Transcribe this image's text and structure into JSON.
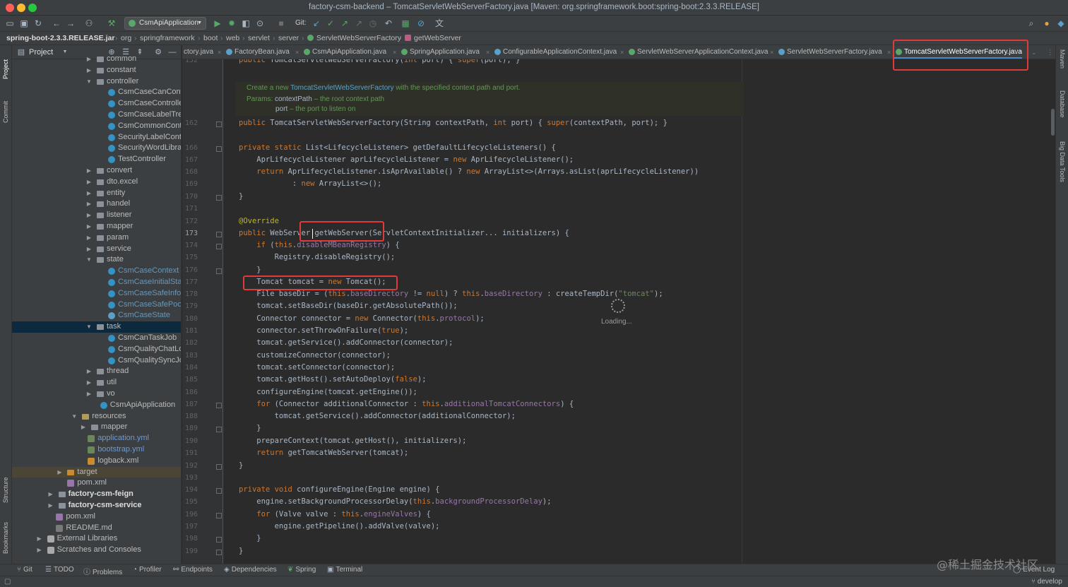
{
  "window": {
    "title": "factory-csm-backend – TomcatServletWebServerFactory.java [Maven: org.springframework.boot:spring-boot:2.3.3.RELEASE]"
  },
  "toolbar": {
    "run_config": "CsmApiApplication",
    "git_label": "Git:"
  },
  "navbar": {
    "crumbs": [
      "spring-boot-2.3.3.RELEASE.jar",
      "org",
      "springframework",
      "boot",
      "web",
      "servlet",
      "server",
      "ServletWebServerFactory",
      "getWebServer"
    ]
  },
  "left_stripe": {
    "tabs": [
      "Project",
      "Commit",
      "Structure",
      "Bookmarks"
    ]
  },
  "right_stripe": {
    "tabs": [
      "Maven",
      "Database",
      "Big Data Tools"
    ]
  },
  "project_panel": {
    "title": "Project",
    "tree": [
      {
        "label": "common",
        "type": "folder",
        "indent": 1,
        "arrow": "right"
      },
      {
        "label": "constant",
        "type": "folder",
        "indent": 1,
        "arrow": "right"
      },
      {
        "label": "controller",
        "type": "folder",
        "indent": 1,
        "arrow": "down"
      },
      {
        "label": "CsmCaseCanControlle",
        "type": "class",
        "indent": 2
      },
      {
        "label": "CsmCaseController",
        "type": "class",
        "indent": 2
      },
      {
        "label": "CsmCaseLabelTreeCo",
        "type": "class",
        "indent": 2
      },
      {
        "label": "CsmCommonControlle",
        "type": "class",
        "indent": 2
      },
      {
        "label": "SecurityLabelControlle",
        "type": "class",
        "indent": 2
      },
      {
        "label": "SecurityWordLibraryC",
        "type": "class",
        "indent": 2
      },
      {
        "label": "TestController",
        "type": "class",
        "indent": 2
      },
      {
        "label": "convert",
        "type": "folder",
        "indent": 1,
        "arrow": "right"
      },
      {
        "label": "dto.excel",
        "type": "folder",
        "indent": 1,
        "arrow": "right"
      },
      {
        "label": "entity",
        "type": "folder",
        "indent": 1,
        "arrow": "right"
      },
      {
        "label": "handel",
        "type": "folder",
        "indent": 1,
        "arrow": "right"
      },
      {
        "label": "listener",
        "type": "folder",
        "indent": 1,
        "arrow": "right"
      },
      {
        "label": "mapper",
        "type": "folder",
        "indent": 1,
        "arrow": "right"
      },
      {
        "label": "param",
        "type": "folder",
        "indent": 1,
        "arrow": "right"
      },
      {
        "label": "service",
        "type": "folder",
        "indent": 1,
        "arrow": "right"
      },
      {
        "label": "state",
        "type": "folder",
        "indent": 1,
        "arrow": "down"
      },
      {
        "label": "CsmCaseContext",
        "type": "class-blue",
        "indent": 2
      },
      {
        "label": "CsmCaseInitialState",
        "type": "class-blue",
        "indent": 2
      },
      {
        "label": "CsmCaseSafeInfoState",
        "type": "class-blue",
        "indent": 2
      },
      {
        "label": "CsmCaseSafePoolStat",
        "type": "class-blue",
        "indent": 2
      },
      {
        "label": "CsmCaseState",
        "type": "interface-blue",
        "indent": 2
      },
      {
        "label": "task",
        "type": "folder",
        "indent": 1,
        "arrow": "down",
        "selected": true
      },
      {
        "label": "CsmCanTaskJob",
        "type": "class",
        "indent": 2
      },
      {
        "label": "CsmQualityChatLogJo",
        "type": "class",
        "indent": 2
      },
      {
        "label": "CsmQualitySyncJob",
        "type": "class",
        "indent": 2
      },
      {
        "label": "thread",
        "type": "folder",
        "indent": 1,
        "arrow": "right"
      },
      {
        "label": "util",
        "type": "folder",
        "indent": 1,
        "arrow": "right"
      },
      {
        "label": "vo",
        "type": "folder",
        "indent": 1,
        "arrow": "right"
      },
      {
        "label": "CsmApiApplication",
        "type": "class",
        "indent": 1.3
      },
      {
        "label": "resources",
        "type": "folder-res",
        "indent": -0.3,
        "arrow": "down"
      },
      {
        "label": "mapper",
        "type": "folder",
        "indent": 0.5,
        "arrow": "right"
      },
      {
        "label": "application.yml",
        "type": "yml",
        "indent": 0.2
      },
      {
        "label": "bootstrap.yml",
        "type": "yml",
        "indent": 0.2
      },
      {
        "label": "logback.xml",
        "type": "xml",
        "indent": 0.2
      },
      {
        "label": "target",
        "type": "folder-target",
        "indent": -1.6,
        "arrow": "right",
        "highlight": true
      },
      {
        "label": "pom.xml",
        "type": "mod",
        "indent": -1.6
      },
      {
        "label": "factory-csm-feign",
        "type": "module",
        "indent": -2.4,
        "arrow": "right"
      },
      {
        "label": "factory-csm-service",
        "type": "module",
        "indent": -2.4,
        "arrow": "right"
      },
      {
        "label": "pom.xml",
        "type": "mod",
        "indent": -2.6
      },
      {
        "label": "README.md",
        "type": "md",
        "indent": -2.6
      },
      {
        "label": "External Libraries",
        "type": "lib",
        "indent": -3.4,
        "arrow": "right"
      },
      {
        "label": "Scratches and Consoles",
        "type": "lib",
        "indent": -3.4,
        "arrow": "right"
      }
    ]
  },
  "tabs": [
    {
      "label": "ctory.java",
      "icon": "class"
    },
    {
      "label": "FactoryBean.java",
      "icon": "interface"
    },
    {
      "label": "CsmApiApplication.java",
      "icon": "class"
    },
    {
      "label": "SpringApplication.java",
      "icon": "class"
    },
    {
      "label": "ConfigurableApplicationContext.java",
      "icon": "interface"
    },
    {
      "label": "ServletWebServerApplicationContext.java",
      "icon": "class"
    },
    {
      "label": "ServletWebServerFactory.java",
      "icon": "interface"
    },
    {
      "label": "TomcatServletWebServerFactory.java",
      "icon": "class",
      "active": true
    }
  ],
  "editor": {
    "doc": {
      "line1_pre": "Create a new ",
      "line1_link": "TomcatServletWebServerFactory",
      "line1_post": " with the specified context path and port.",
      "params_label": "Params:",
      "param1_name": "contextPath",
      "param1_desc": " – the root context path",
      "param2_name": "port",
      "param2_desc": " – the port to listen on"
    },
    "line_numbers": [
      "152",
      "",
      "",
      "",
      "162",
      "166",
      "167",
      "168",
      "169",
      "170",
      "171",
      "172",
      "173",
      "174",
      "175",
      "176",
      "177",
      "178",
      "179",
      "180",
      "181",
      "182",
      "183",
      "184",
      "185",
      "186",
      "187",
      "188",
      "189",
      "190",
      "191",
      "192",
      "193",
      "194",
      "195",
      "196",
      "197",
      "198",
      "199"
    ],
    "loading_text": "Loading...",
    "code": {
      "l152": "public TomcatServletWebServerFactory(int port) { super(port); }",
      "l162": "public TomcatServletWebServerFactory(String contextPath, int port) { super(contextPath, port); }",
      "l166": "private static List<LifecycleListener> getDefaultLifecycleListeners() {",
      "l167": "    AprLifecycleListener aprLifecycleListener = new AprLifecycleListener();",
      "l168": "    return AprLifecycleListener.isAprAvailable() ? new ArrayList<>(Arrays.asList(aprLifecycleListener))",
      "l169": "            : new ArrayList<>();",
      "l170": "}",
      "l172": "@Override",
      "l173": "public WebServer getWebServer(ServletContextInitializer... initializers) {",
      "l174": "    if (this.disableMBeanRegistry) {",
      "l175": "        Registry.disableRegistry();",
      "l176": "    }",
      "l177": "    Tomcat tomcat = new Tomcat();",
      "l178": "    File baseDir = (this.baseDirectory != null) ? this.baseDirectory : createTempDir(\"tomcat\");",
      "l179": "    tomcat.setBaseDir(baseDir.getAbsolutePath());",
      "l180": "    Connector connector = new Connector(this.protocol);",
      "l181": "    connector.setThrowOnFailure(true);",
      "l182": "    tomcat.getService().addConnector(connector);",
      "l183": "    customizeConnector(connector);",
      "l184": "    tomcat.setConnector(connector);",
      "l185": "    tomcat.getHost().setAutoDeploy(false);",
      "l186": "    configureEngine(tomcat.getEngine());",
      "l187": "    for (Connector additionalConnector : this.additionalTomcatConnectors) {",
      "l188": "        tomcat.getService().addConnector(additionalConnector);",
      "l189": "    }",
      "l190": "    prepareContext(tomcat.getHost(), initializers);",
      "l191": "    return getTomcatWebServer(tomcat);",
      "l192": "}",
      "l194": "private void configureEngine(Engine engine) {",
      "l195": "    engine.setBackgroundProcessorDelay(this.backgroundProcessorDelay);",
      "l196": "    for (Valve valve : this.engineValves) {",
      "l197": "        engine.getPipeline().addValve(valve);",
      "l198": "    }",
      "l199": "}"
    }
  },
  "bottom_tabs": [
    "Git",
    "TODO",
    "Problems",
    "Profiler",
    "Endpoints",
    "Dependencies",
    "Spring",
    "Terminal",
    "Event Log"
  ],
  "status": {
    "branch": "develop"
  },
  "watermark": "@稀土掘金技术社区",
  "colors": {
    "highlight_box": "#e03a3a",
    "accent": "#4a88c7"
  }
}
